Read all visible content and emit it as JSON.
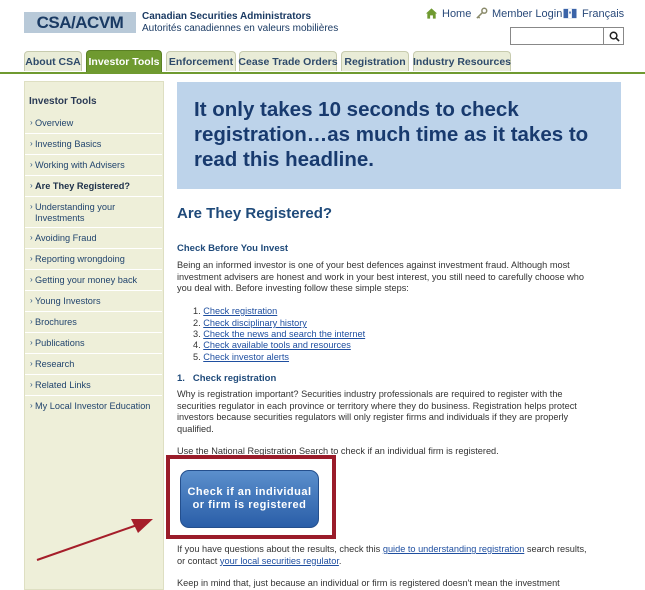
{
  "header": {
    "logo_text": "CSA/ACVM",
    "org_name_en": "Canadian Securities Administrators",
    "org_name_fr": "Autorités canadiennes en valeurs mobilières",
    "links": {
      "home": "Home",
      "login": "Member Login",
      "french": "Français"
    },
    "search": {
      "value": "",
      "placeholder": ""
    },
    "icons": {
      "home": "home-icon",
      "login": "key-icon",
      "french": "flag-icon",
      "search": "search-icon"
    }
  },
  "tabs": [
    {
      "label": "About CSA"
    },
    {
      "label": "Investor Tools",
      "active": true
    },
    {
      "label": "Enforcement"
    },
    {
      "label": "Cease Trade Orders"
    },
    {
      "label": "Registration"
    },
    {
      "label": "Industry Resources"
    }
  ],
  "sidebar": {
    "title": "Investor Tools",
    "items": [
      {
        "label": "Overview"
      },
      {
        "label": "Investing Basics"
      },
      {
        "label": "Working with Advisers"
      },
      {
        "label": "Are They Registered?",
        "current": true
      },
      {
        "label": "Understanding your\nInvestments"
      },
      {
        "label": "Avoiding Fraud"
      },
      {
        "label": "Reporting wrongdoing"
      },
      {
        "label": "Getting your money back"
      },
      {
        "label": "Young Investors"
      },
      {
        "label": "Brochures"
      },
      {
        "label": "Publications"
      },
      {
        "label": "Research"
      },
      {
        "label": "Related Links"
      },
      {
        "label": "My Local Investor Education"
      }
    ]
  },
  "main": {
    "banner": "It only takes 10 seconds to check registration…as much time as it takes to read this headline.",
    "heading": "Are They Registered?",
    "check_heading": "Check Before You Invest",
    "intro": "Being an informed investor is one of your best defences against investment fraud. Although most investment advisers are honest and work in your best interest, you still need to carefully choose who you deal with. Before investing follow these simple steps:",
    "steps": [
      {
        "num": "1.",
        "label": "Check registration"
      },
      {
        "num": "2.",
        "label": "Check disciplinary history"
      },
      {
        "num": "3.",
        "label": "Check the news and search the internet"
      },
      {
        "num": "4.",
        "label": "Check available tools and resources"
      },
      {
        "num": "5.",
        "label": "Check investor alerts"
      }
    ],
    "step1_heading": "1.   Check registration",
    "why": "Why is registration important? Securities industry professionals are required to register with the securities regulator in each province or territory where they do business. Registration helps protect investors because securities regulators will only register firms and individuals if they are properly qualified.",
    "use_search": "Use the National Registration Search to check if an individual firm is registered.",
    "check_button": "Check if an individual or firm is registered",
    "questions": {
      "before": "If you have questions about the results, check this ",
      "link1": "guide to understanding registration",
      "middle": " search results, or contact ",
      "link2": "your local securities regulator",
      "after": "."
    },
    "keep_in_mind": "Keep in mind that, just because an individual or firm is registered doesn't mean the investment"
  },
  "colors": {
    "tab_active": "#6f9a30",
    "banner_bg": "#bdd3ea",
    "heading_blue": "#1f4a7a",
    "callout_border": "#9a1c2a",
    "button_blue": "#2a5ea8",
    "sidebar_bg": "#eeefd9"
  }
}
